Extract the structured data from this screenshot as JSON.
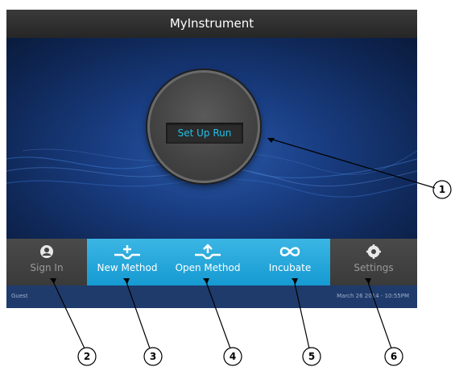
{
  "window": {
    "title": "MyInstrument"
  },
  "main": {
    "setup_button": "Set Up Run"
  },
  "nav": {
    "sign_in": "Sign In",
    "new_method": "New Method",
    "open_method": "Open Method",
    "incubate": "Incubate",
    "settings": "Settings"
  },
  "status": {
    "user": "Guest",
    "datetime": "March 26 2014 - 10:55PM"
  },
  "callouts": [
    "1",
    "2",
    "3",
    "4",
    "5",
    "6"
  ],
  "colors": {
    "accent_blue": "#1aa3d8",
    "setup_text": "#22c0e6",
    "background": "#1a3f85",
    "bar_grey": "#3e3e3e"
  },
  "icons": {
    "sign_in": "user-icon",
    "new_method": "new-method-icon",
    "open_method": "open-method-icon",
    "incubate": "infinity-icon",
    "settings": "gear-icon"
  }
}
